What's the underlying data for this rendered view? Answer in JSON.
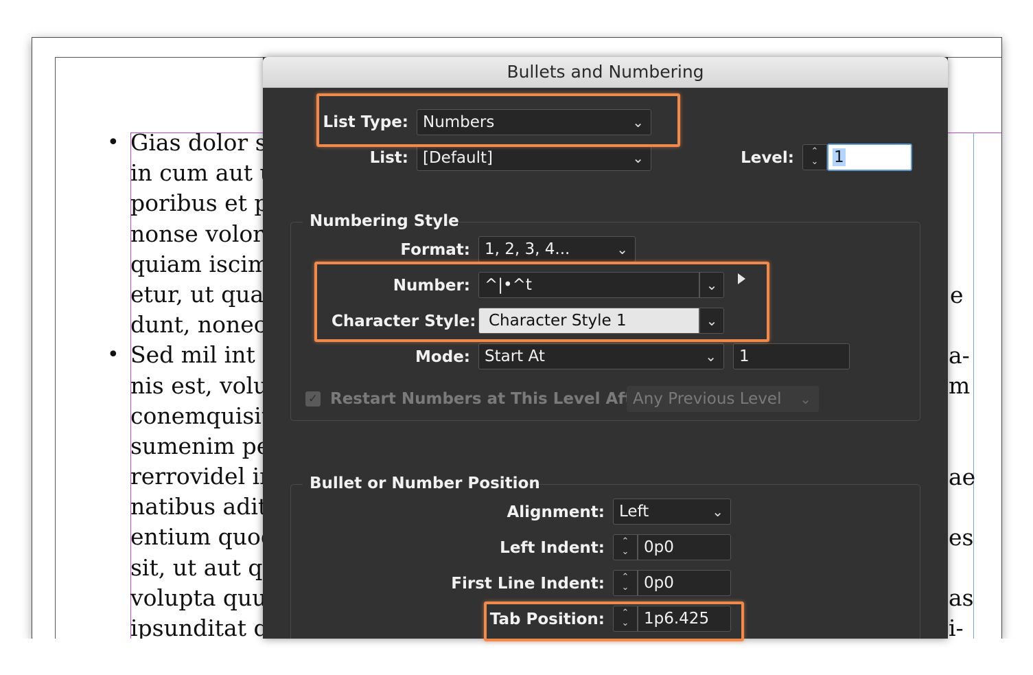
{
  "document": {
    "left_lines": [
      "Gias dolor se",
      "in cum aut ut",
      "poribus et pre",
      "nonse volorit",
      "quiam iscime",
      "etur, ut quass",
      "dunt, nonece",
      "Sed mil int ut",
      "nis est, volup",
      "conemquisiti",
      "sumenim pel",
      "rerrovidel int",
      "natibus aditas",
      "entium quodi",
      "sit, ut aut que",
      "volupta quun",
      "ipsunditat qu"
    ],
    "right_fragments": [
      "e",
      "a-",
      "m",
      "ae",
      "es",
      "as",
      "i-"
    ]
  },
  "dialog": {
    "title": "Bullets and Numbering",
    "list_type_label": "List Type:",
    "list_type_value": "Numbers",
    "list_label": "List:",
    "list_value": "[Default]",
    "level_label": "Level:",
    "level_value": "1",
    "numbering_style": {
      "section_title": "Numbering Style",
      "format_label": "Format:",
      "format_value": "1, 2, 3, 4...",
      "number_label": "Number:",
      "number_value": "^|•^t",
      "char_style_label": "Character Style:",
      "char_style_value": "Character Style 1",
      "mode_label": "Mode:",
      "mode_value": "Start At",
      "start_value": "1",
      "restart_label": "Restart Numbers at This Level After:",
      "restart_value": "Any Previous Level"
    },
    "position": {
      "section_title": "Bullet or Number Position",
      "alignment_label": "Alignment:",
      "alignment_value": "Left",
      "left_indent_label": "Left Indent:",
      "left_indent_value": "0p0",
      "first_line_label": "First Line Indent:",
      "first_line_value": "0p0",
      "tab_position_label": "Tab Position:",
      "tab_position_value": "1p6.425"
    }
  },
  "colors": {
    "highlight": "#ef8a4c",
    "dialog_bg": "#323232",
    "guide_magenta": "#c64ac6"
  }
}
